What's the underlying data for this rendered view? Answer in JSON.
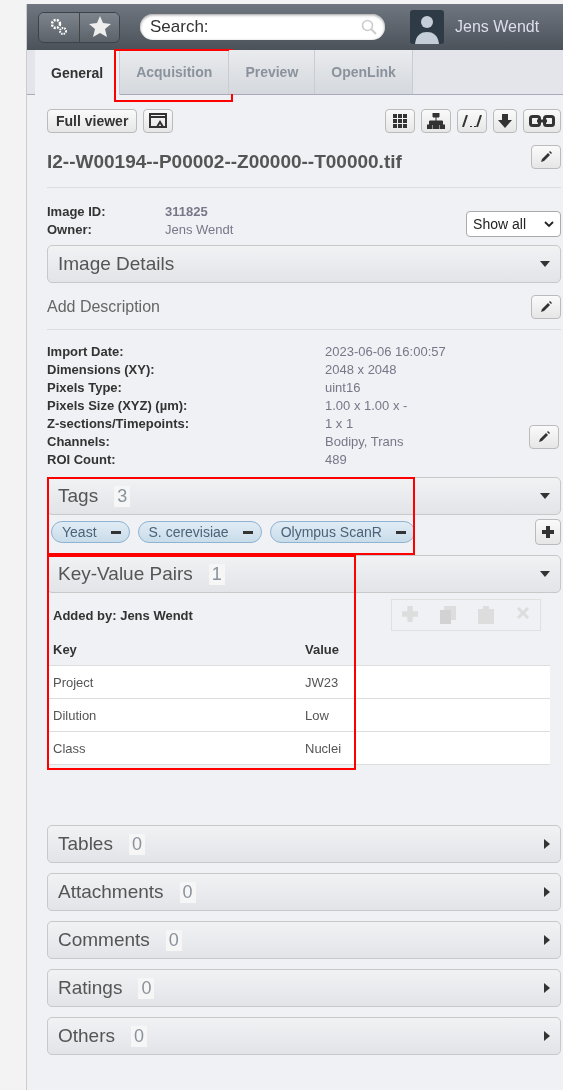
{
  "header": {
    "search": {
      "placeholder": "Search:"
    },
    "user": "Jens Wendt"
  },
  "tabs": [
    {
      "label": "General",
      "selected": true,
      "highlighted": false
    },
    {
      "label": "Acquisition",
      "selected": false,
      "highlighted": true
    },
    {
      "label": "Preview",
      "selected": false,
      "highlighted": false
    },
    {
      "label": "OpenLink",
      "selected": false,
      "highlighted": false
    }
  ],
  "toolbar": {
    "full_viewer": "Full viewer"
  },
  "image_name": "I2--W00194--P00002--Z00000--T00000.tif",
  "owner_info": [
    {
      "label": "Image ID:",
      "value": "311825",
      "bold": true
    },
    {
      "label": "Owner:",
      "value": "Jens Wendt",
      "bold": false
    }
  ],
  "show_filter": "Show all",
  "image_details": {
    "title": "Image Details",
    "expanded": true
  },
  "description": {
    "placeholder": "Add Description"
  },
  "details": [
    {
      "label": "Import Date:",
      "value": "2023-06-06 16:00:57"
    },
    {
      "label": "Dimensions (XY):",
      "value": "2048 x 2048"
    },
    {
      "label": "Pixels Type:",
      "value": "uint16"
    },
    {
      "label": "Pixels Size (XYZ) (µm):",
      "value": "1.00 x 1.00 x -"
    },
    {
      "label": "Z-sections/Timepoints:",
      "value": "1 x 1"
    },
    {
      "label": "Channels:",
      "value": "Bodipy, Trans"
    },
    {
      "label": "ROI Count:",
      "value": "489"
    }
  ],
  "tags": {
    "title": "Tags",
    "count": "3",
    "expanded": true,
    "highlighted": true,
    "items": [
      "Yeast",
      "S. cerevisiae",
      "Olympus ScanR"
    ]
  },
  "key_value": {
    "title": "Key-Value Pairs",
    "count": "1",
    "expanded": true,
    "highlighted": true,
    "added_by": "Added by: Jens Wendt",
    "columns": [
      "Key",
      "Value"
    ],
    "rows": [
      [
        "Project",
        "JW23"
      ],
      [
        "Dilution",
        "Low"
      ],
      [
        "Class",
        "Nuclei"
      ]
    ]
  },
  "sections": [
    {
      "title": "Tables",
      "count": "0",
      "expanded": false
    },
    {
      "title": "Attachments",
      "count": "0",
      "expanded": false
    },
    {
      "title": "Comments",
      "count": "0",
      "expanded": false
    },
    {
      "title": "Ratings",
      "count": "0",
      "expanded": false
    },
    {
      "title": "Others",
      "count": "0",
      "expanded": false
    }
  ]
}
